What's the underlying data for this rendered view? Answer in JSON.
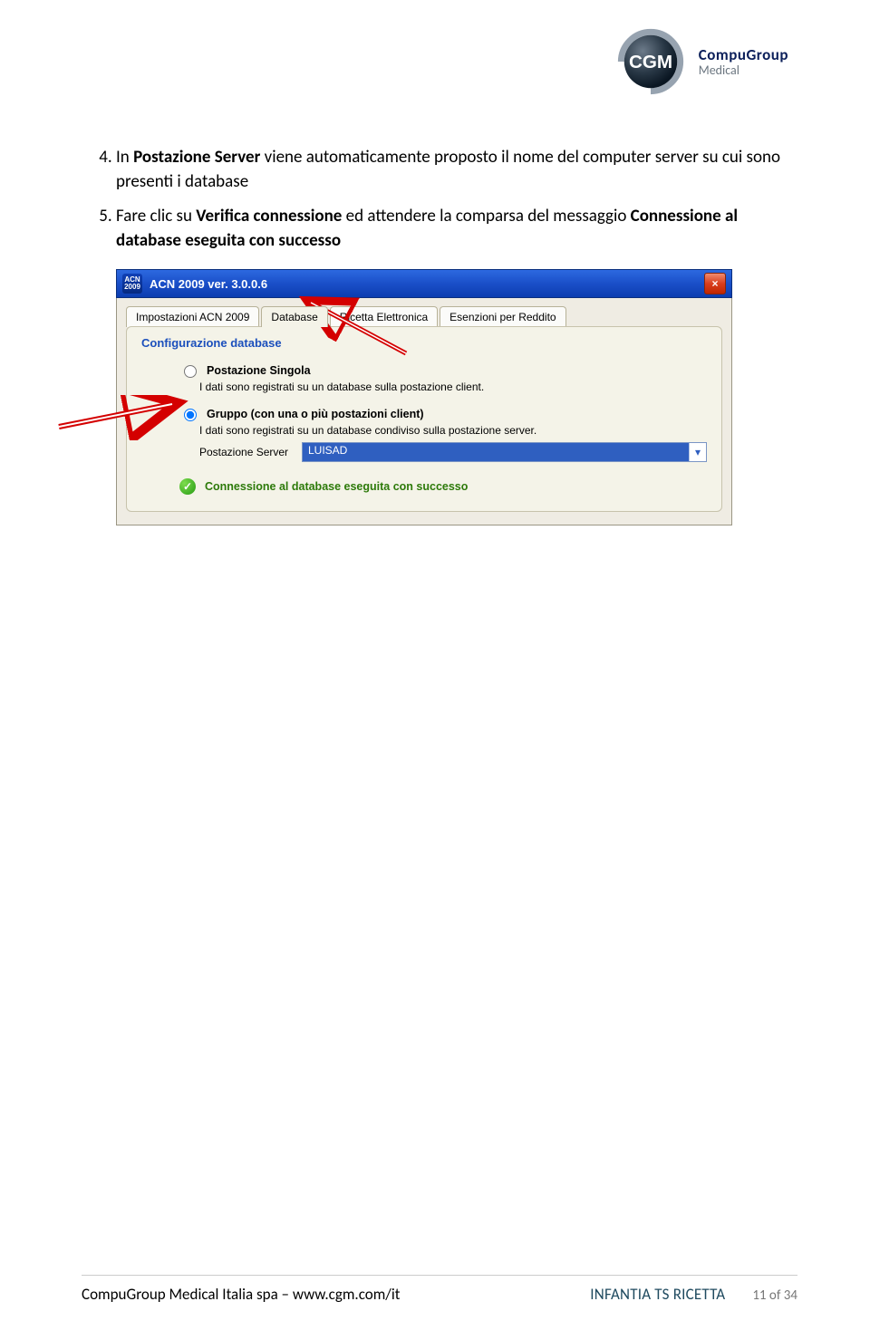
{
  "header": {
    "brand_line1": "CompuGroup",
    "brand_line2": "Medical",
    "badge": "CGM"
  },
  "instructions": {
    "start_num": 4,
    "items": [
      {
        "prefix": "In ",
        "bold1": "Postazione Server",
        "rest": " viene automaticamente proposto il nome del computer server su cui sono presenti i database"
      },
      {
        "prefix": "Fare clic su ",
        "bold1": "Verifica connessione",
        "mid": " ed attendere la comparsa del messaggio ",
        "bold2": "Connessione al database eseguita con successo"
      }
    ]
  },
  "screenshot": {
    "titlebar_icon": "ACN\n2009",
    "window_title": "ACN 2009 ver. 3.0.0.6",
    "close_x": "×",
    "tabs": [
      {
        "label": "Impostazioni ACN 2009",
        "active": false
      },
      {
        "label": "Database",
        "active": true
      },
      {
        "label": "Ricetta Elettronica",
        "active": false
      },
      {
        "label": "Esenzioni per Reddito",
        "active": false
      }
    ],
    "group_title": "Configurazione database",
    "option1": {
      "title": "Postazione Singola",
      "desc": "I dati sono registrati su un database sulla postazione client."
    },
    "option2": {
      "title": "Gruppo (con una o più postazioni client)",
      "desc": "I dati sono registrati su un database condiviso sulla postazione server.",
      "server_label": "Postazione Server",
      "server_value": "LUISAD"
    },
    "status": "Connessione al database eseguita con successo"
  },
  "footer": {
    "left": "CompuGroup Medical Italia spa – www.cgm.com/it",
    "mid": "INFANTIA TS RICETTA",
    "right": "11 of 34"
  }
}
